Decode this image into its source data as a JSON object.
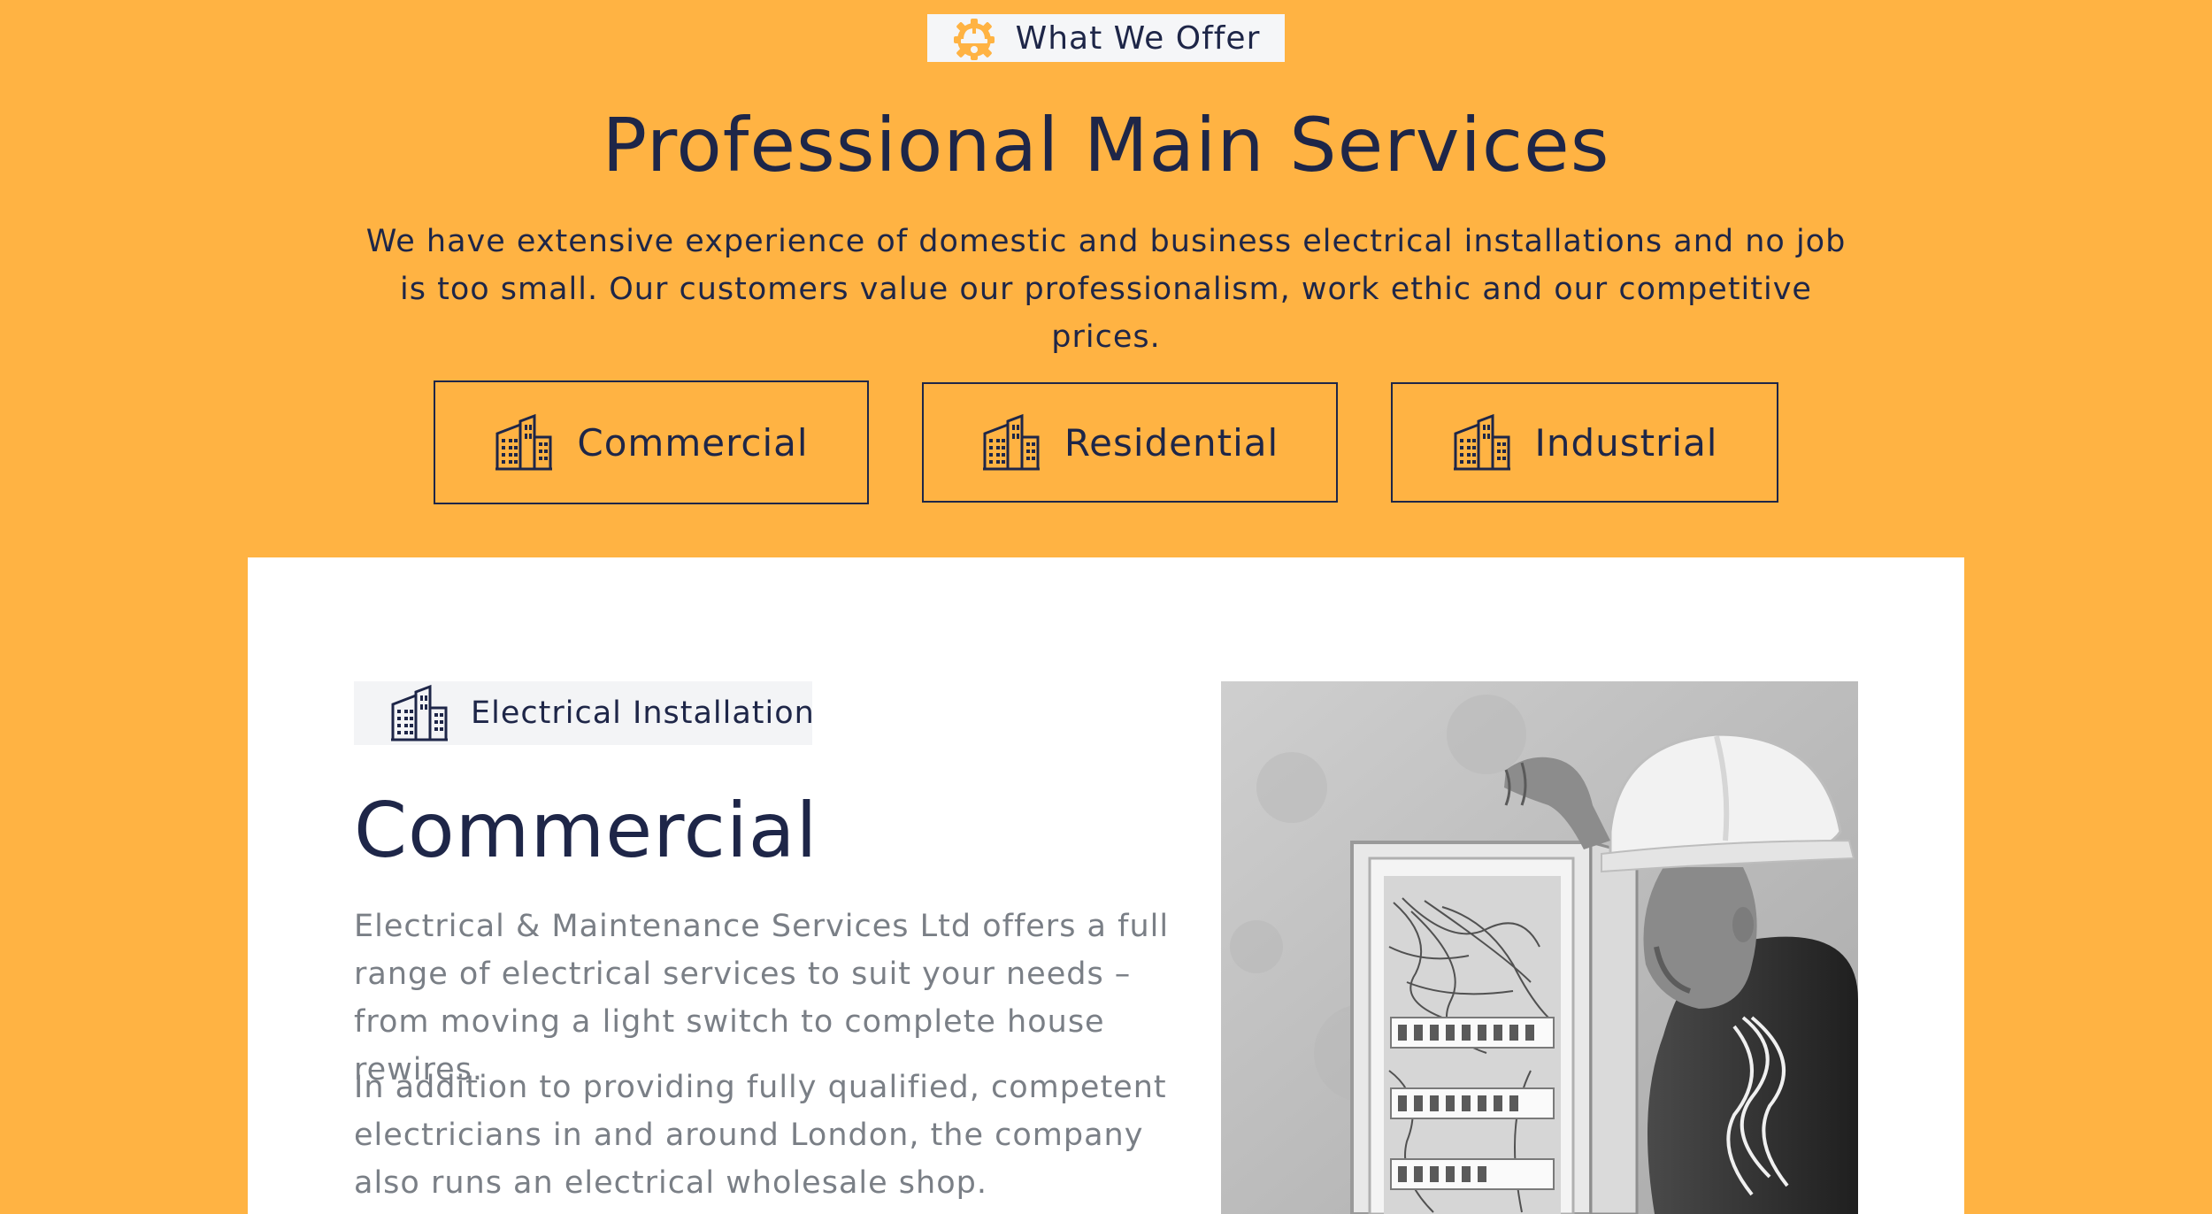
{
  "section_badge": {
    "label": "What We Offer",
    "icon": "helmet-gear-icon"
  },
  "title": "Professional Main Services",
  "lead": "We have extensive experience of domestic and business electrical installations and no job is too small. Our customers value our professionalism, work ethic and our competitive prices.",
  "tabs": [
    {
      "label": "Commercial",
      "icon": "buildings-icon"
    },
    {
      "label": "Residential",
      "icon": "buildings-icon"
    },
    {
      "label": "Industrial",
      "icon": "buildings-icon"
    }
  ],
  "panel": {
    "tag_label": "Electrical Installation",
    "tag_icon": "buildings-icon",
    "heading": "Commercial",
    "paragraphs": [
      "Electrical & Maintenance Services Ltd offers a full range of electrical services to suit your needs – from moving a light switch to complete house rewires.",
      "In addition to providing fully qualified, competent electricians in and around London, the company also runs an electrical wholesale shop."
    ],
    "image": "electrician-at-fuse-board-photo"
  },
  "colors": {
    "background": "#FFB343",
    "navy": "#1E2648",
    "muted_text": "#7A7F86",
    "badge_bg": "#F5F6F8",
    "card_bg": "#FFFFFF"
  }
}
